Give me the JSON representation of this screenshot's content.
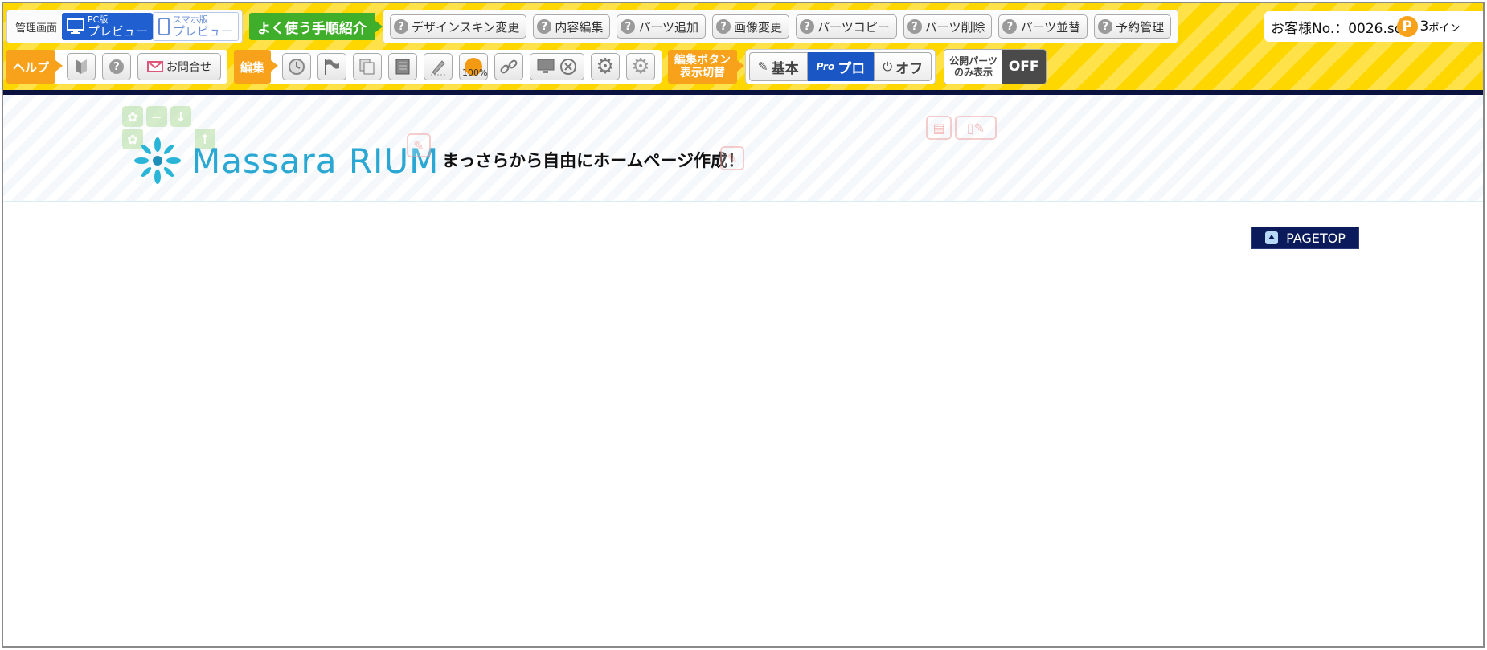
{
  "toolbar": {
    "admin_label": "管理画面",
    "pc_preview": {
      "small": "PC版",
      "big": "プレビュー"
    },
    "sp_preview": {
      "small": "スマホ版",
      "big": "プレビュー"
    },
    "howto_label": "よく使う手順紹介",
    "howto_items": [
      "デザインスキン変更",
      "内容編集",
      "パーツ追加",
      "画像変更",
      "パーツコピー",
      "パーツ削除",
      "パーツ並替",
      "予約管理"
    ],
    "help_label": "ヘルプ",
    "contact_label": "お問合せ",
    "edit_label": "編集",
    "zoom_label": "100%",
    "editbtn_toggle": {
      "line1": "編集ボタン",
      "line2": "表示切替"
    },
    "modes": [
      "基本",
      "プロ",
      "オフ"
    ],
    "active_mode": "プロ",
    "public_parts": {
      "line1": "公開パーツ",
      "line2": "のみ表示",
      "state": "OFF"
    },
    "customer_text": "お客様No.：0026.sd",
    "points_badge": "P",
    "points_value": "3",
    "points_suffix": "ポイン"
  },
  "header": {
    "logo_text": "Massara RIUM",
    "tagline": "まっさらから自由にホームページ作成！"
  },
  "pagetop_label": "PAGETOP",
  "colors": {
    "toolbar_yellow": "#ffd700",
    "accent_blue": "#1a56c4",
    "howto_green": "#3fae2a",
    "tag_orange": "#f7a21a",
    "navy": "#0b1240",
    "logo_teal": "#2aa7d2"
  },
  "icons": [
    "beginner-icon",
    "help-icon",
    "mail-icon",
    "clock-icon",
    "flag-icon",
    "copy-icon",
    "notebook-icon",
    "pen-icon",
    "orange-circle-icon",
    "link-icon",
    "monitor-icon",
    "close-icon",
    "gear-icon",
    "gear-advanced-icon",
    "pencil-icon",
    "pro-icon",
    "power-icon"
  ]
}
